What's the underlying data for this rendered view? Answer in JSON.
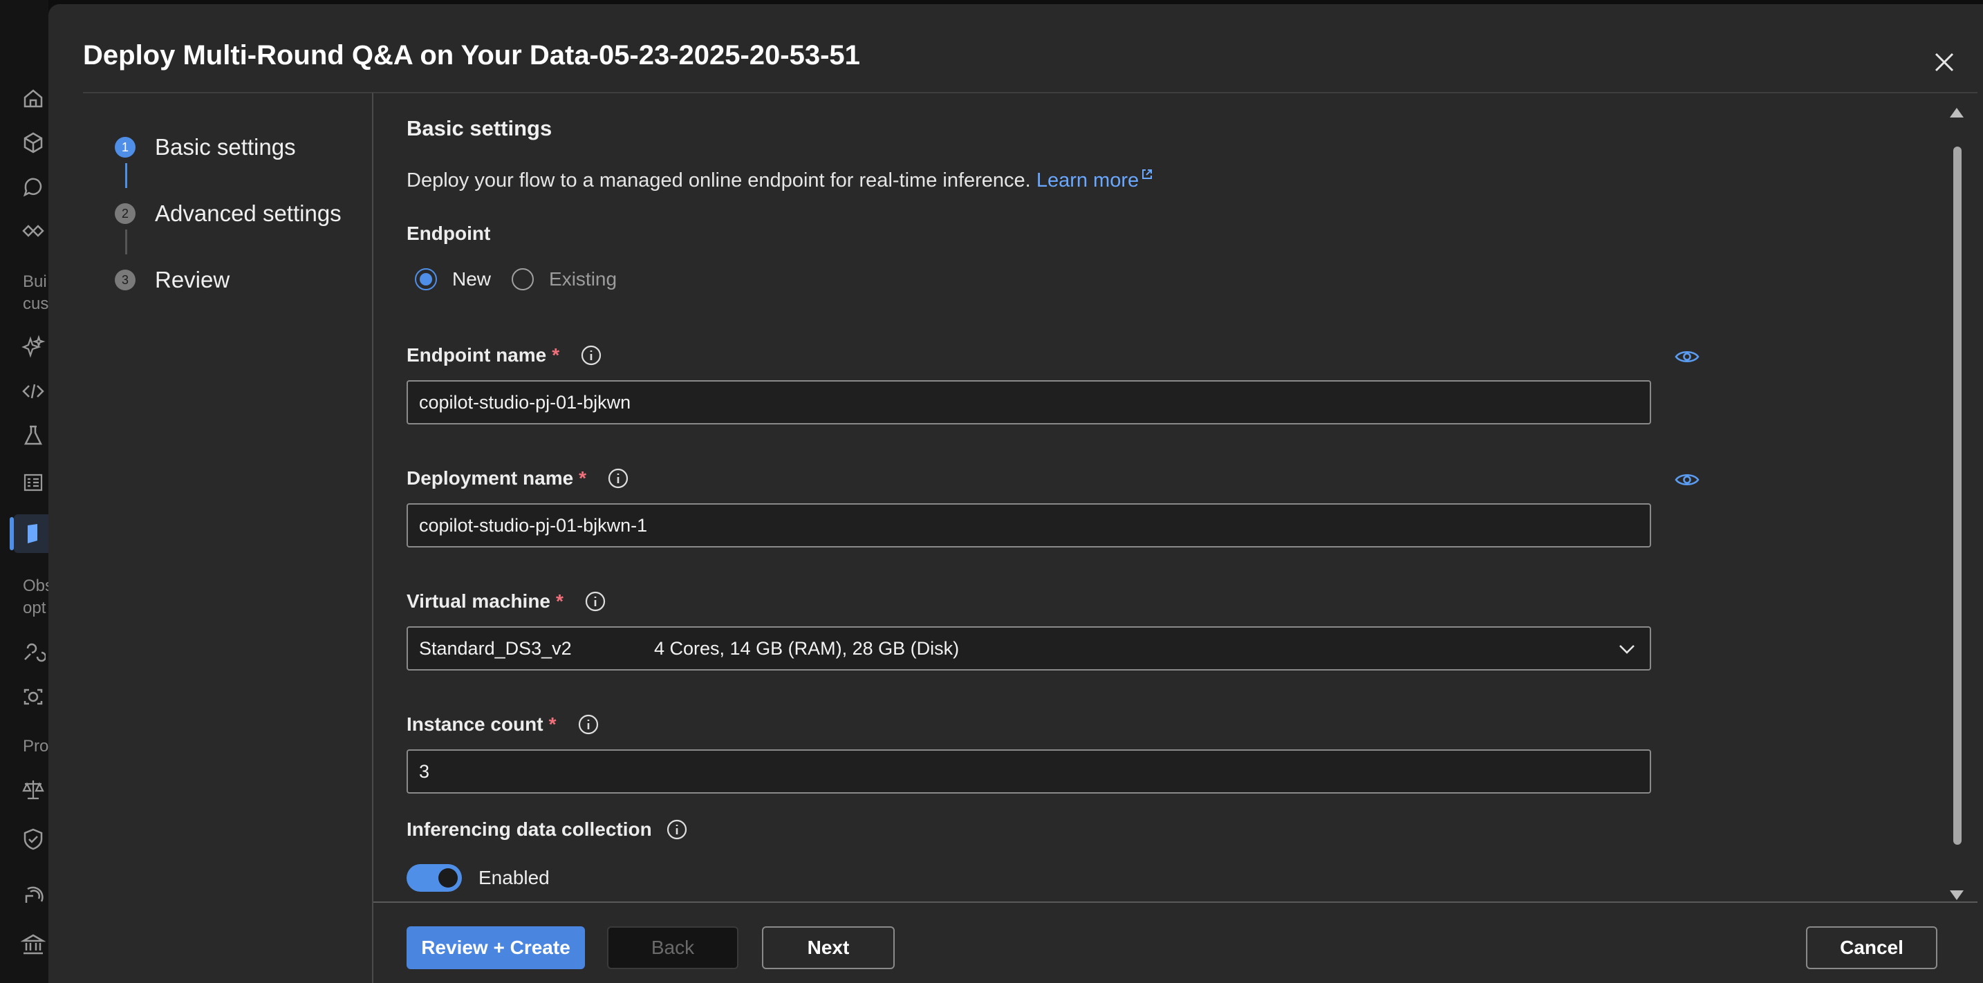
{
  "rail": {
    "section_build": [
      "Bui",
      "cus"
    ],
    "section_observe": [
      "Obs",
      "opt"
    ],
    "section_protect": [
      "Pro"
    ]
  },
  "modal": {
    "title": "Deploy Multi-Round Q&A on Your Data-05-23-2025-20-53-51"
  },
  "steps": [
    {
      "number": "1",
      "label": "Basic settings",
      "current": true
    },
    {
      "number": "2",
      "label": "Advanced settings",
      "current": false
    },
    {
      "number": "3",
      "label": "Review",
      "current": false
    }
  ],
  "form": {
    "section_title": "Basic settings",
    "description": "Deploy your flow to a managed online endpoint for real-time inference.",
    "learn_more": "Learn more",
    "endpoint_label": "Endpoint",
    "endpoint_options": {
      "new": "New",
      "existing": "Existing"
    },
    "endpoint_selected": "New",
    "endpoint_name_label": "Endpoint name",
    "endpoint_name_value": "copilot-studio-pj-01-bjkwn",
    "deployment_name_label": "Deployment name",
    "deployment_name_value": "copilot-studio-pj-01-bjkwn-1",
    "vm_label": "Virtual machine",
    "vm_value": "Standard_DS3_v2",
    "vm_specs": "4 Cores, 14 GB (RAM), 28 GB (Disk)",
    "instance_count_label": "Instance count",
    "instance_count_value": "3",
    "data_collection_label": "Inferencing data collection",
    "data_collection_state": "Enabled",
    "required_mark": "*"
  },
  "footer": {
    "review_create": "Review + Create",
    "back": "Back",
    "next": "Next",
    "cancel": "Cancel"
  },
  "colors": {
    "accent": "#4f8fe8",
    "link": "#6aa8ff",
    "required": "#f1707b",
    "modal_bg": "#292929"
  }
}
